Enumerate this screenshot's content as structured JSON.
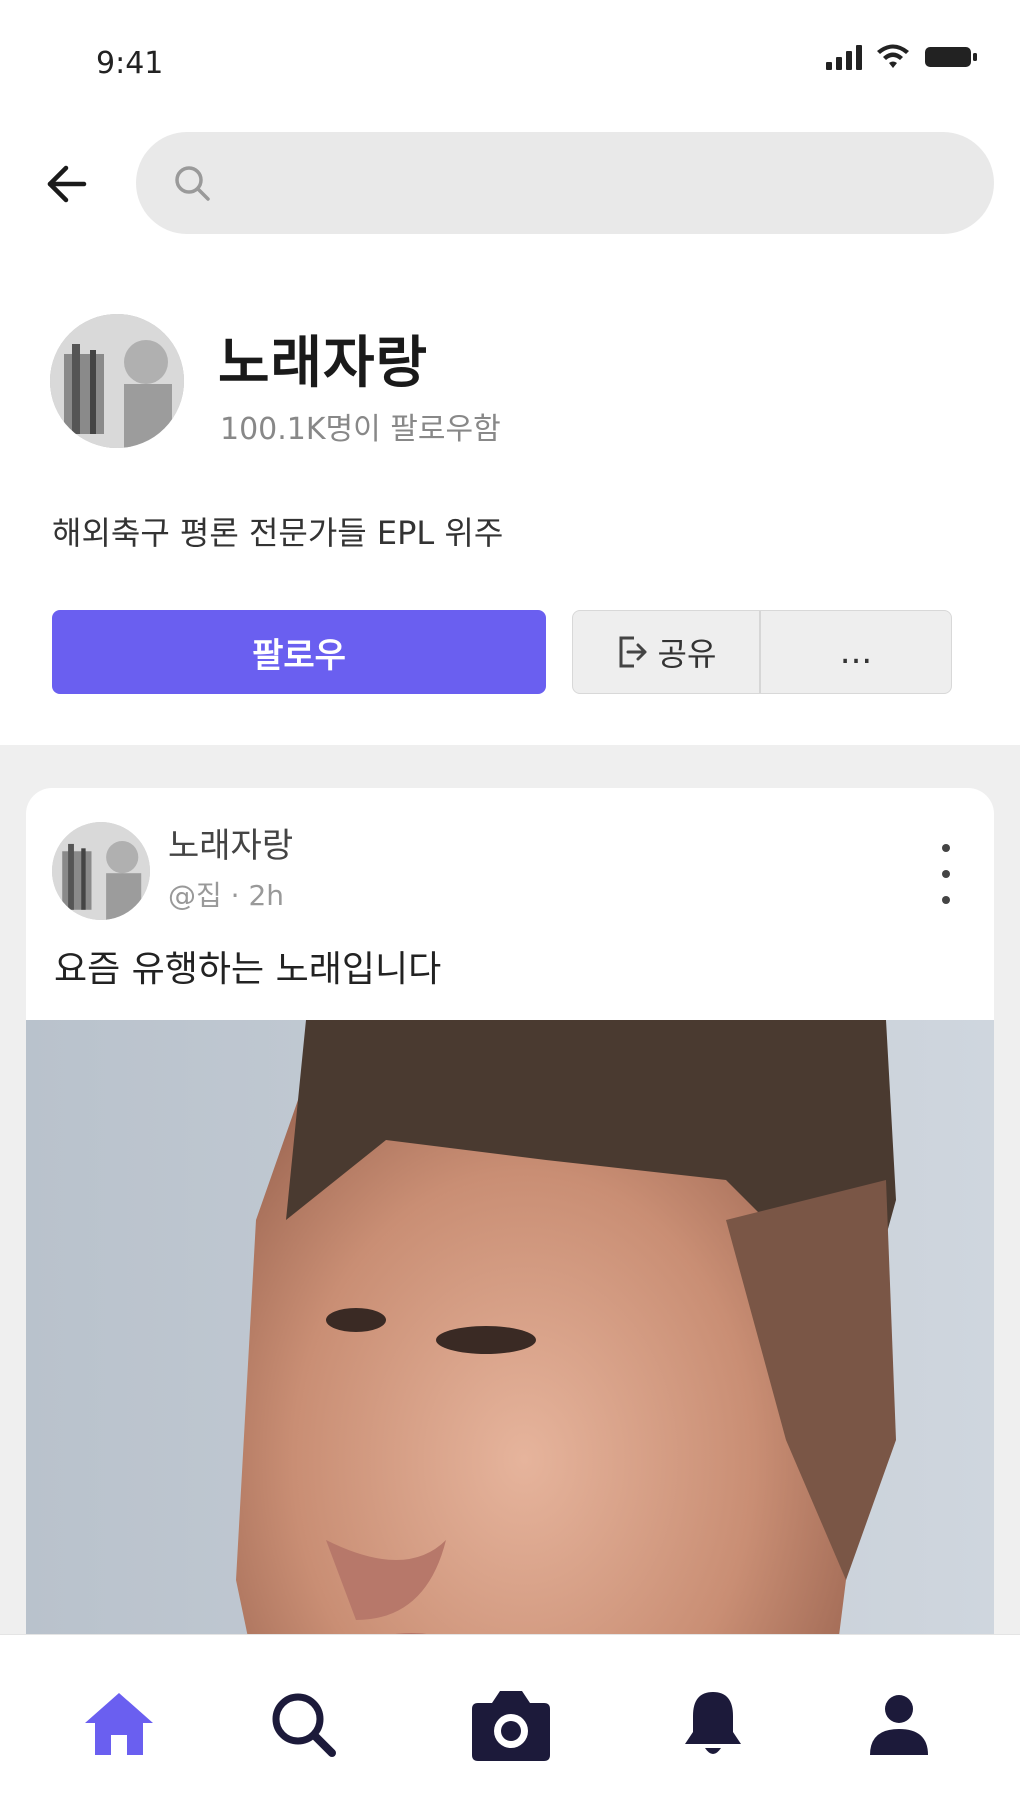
{
  "status_bar": {
    "time": "9:41"
  },
  "search": {
    "placeholder": ""
  },
  "profile": {
    "name": "노래자랑",
    "followers": "100.1K명이 팔로우함",
    "bio": "해외축구 평론 전문가들 EPL 위주",
    "follow_label": "팔로우",
    "share_label": "공유",
    "more_label": "..."
  },
  "post": {
    "author": "노래자랑",
    "meta": "@집 · 2h",
    "text": "요즘 유행하는 노래입니다"
  },
  "colors": {
    "accent": "#6a5ff0",
    "nav_dark": "#1c1a3a"
  },
  "icons": {
    "back": "arrow-left-icon",
    "search": "search-icon",
    "share": "share-icon",
    "nav": [
      "home-icon",
      "search-icon",
      "camera-icon",
      "bell-icon",
      "profile-icon"
    ]
  }
}
